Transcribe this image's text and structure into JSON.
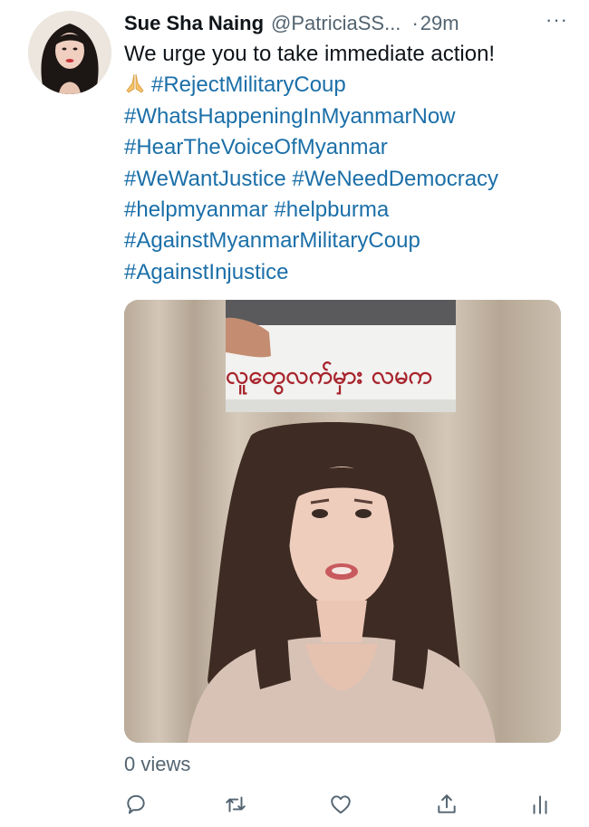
{
  "tweet": {
    "author_name": "Sue Sha Naing",
    "author_handle": "@PatriciaSS...",
    "separator": "·",
    "time": "29m",
    "more_label": "···",
    "text_lines": [
      "We urge you to take immediate action!",
      "#RejectMilitaryCoup",
      "#WhatsHappeningInMyanmarNow",
      "#HearTheVoiceOfMyanmar",
      "#WeWantJustice #WeNeedDemocracy",
      "#helpmyanmar #helpburma",
      "#AgainstMyanmarMilitaryCoup",
      "#AgainstInjustice"
    ],
    "emoji_icon": "folded-hands-icon",
    "media": {
      "sign_text": "လူတွေလက်မှား လမက",
      "type": "video-thumbnail"
    },
    "views": "0 views",
    "actions": [
      {
        "icon": "reply-icon"
      },
      {
        "icon": "retweet-icon"
      },
      {
        "icon": "like-icon"
      },
      {
        "icon": "share-icon"
      },
      {
        "icon": "analytics-icon"
      }
    ]
  },
  "colors": {
    "hashtag": "#1b6fa8",
    "secondary_text": "#536471",
    "primary_text": "#0f1419",
    "background": "#ffffff"
  }
}
